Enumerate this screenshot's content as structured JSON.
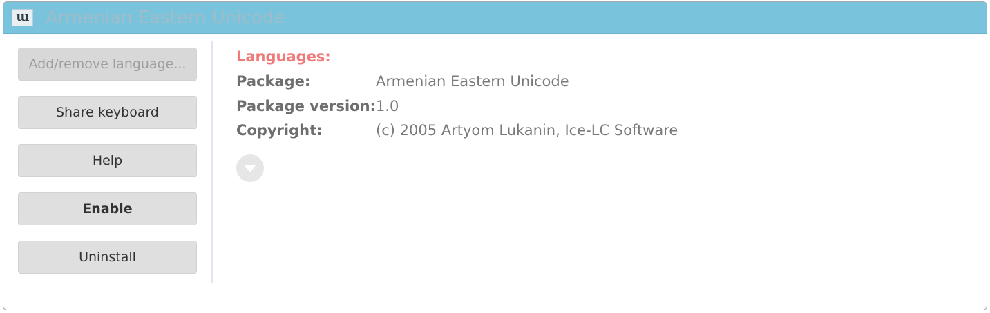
{
  "window": {
    "icon_label": "ա",
    "title": "Armenian Eastern Unicode"
  },
  "actions": {
    "add_remove_language": "Add/remove language...",
    "share_keyboard": "Share keyboard",
    "help": "Help",
    "enable": "Enable",
    "uninstall": "Uninstall"
  },
  "details": {
    "languages_label": "Languages:",
    "package_label": "Package:",
    "package_value": "Armenian Eastern Unicode",
    "version_label": "Package version:",
    "version_value": "1.0",
    "copyright_label": "Copyright:",
    "copyright_value": "(c) 2005 Artyom Lukanin, Ice-LC Software"
  },
  "colors": {
    "titlebar": "#7ac3dc",
    "languages_accent": "#f07a7a",
    "button_bg": "#dfdfdf"
  },
  "icons": {
    "window_icon": "keyboard-package-icon",
    "expand_icon": "chevron-down-circle-icon"
  }
}
